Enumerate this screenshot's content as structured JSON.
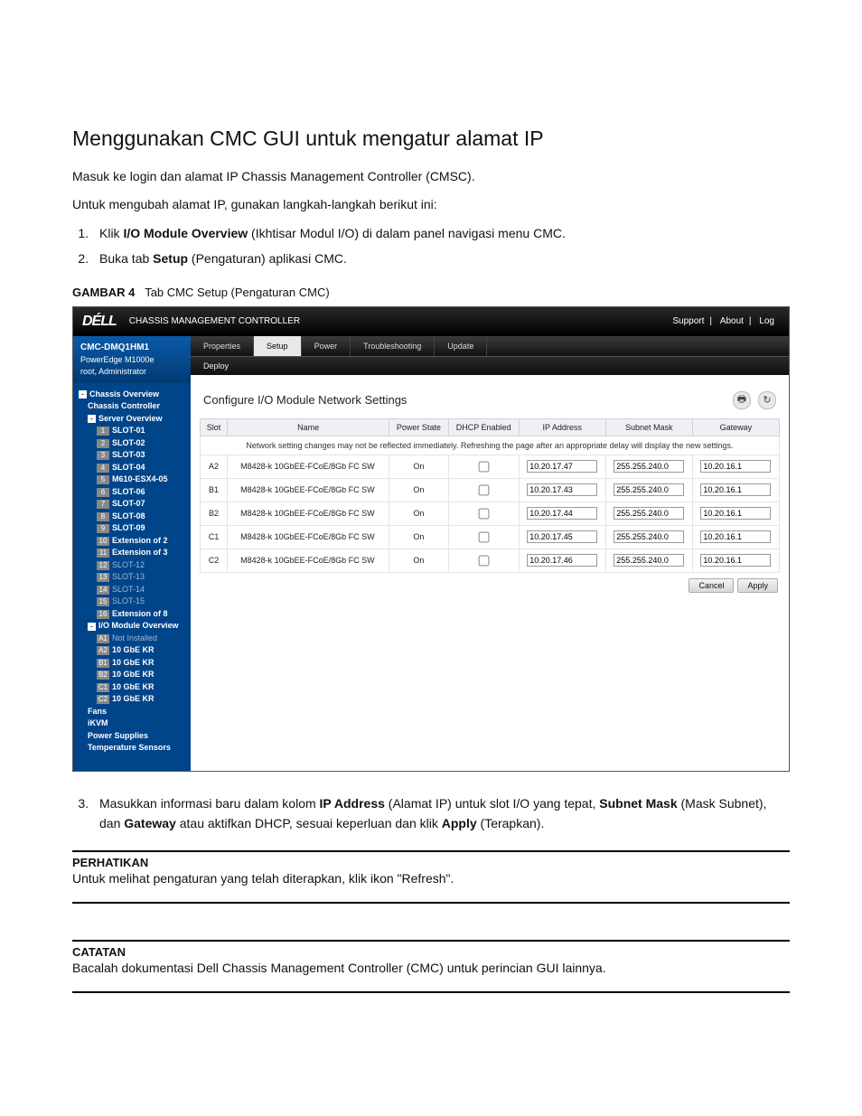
{
  "doc": {
    "heading": "Menggunakan CMC GUI untuk mengatur alamat IP",
    "intro1": "Masuk ke login dan alamat IP Chassis Management Controller (CMSC).",
    "intro2": "Untuk mengubah alamat IP, gunakan langkah-langkah berikut ini:",
    "step1_prefix": "Klik ",
    "step1_bold": "I/O Module Overview",
    "step1_suffix": " (Ikhtisar Modul I/O) di dalam panel navigasi menu CMC.",
    "step2_prefix": "Buka tab ",
    "step2_bold": "Setup",
    "step2_suffix": " (Pengaturan) aplikasi CMC.",
    "figlabel": "GAMBAR 4",
    "figtitle": "Tab CMC Setup (Pengaturan CMC)",
    "step3_a": "Masukkan informasi baru dalam kolom ",
    "step3_b1": "IP Address",
    "step3_b": " (Alamat IP) untuk slot I/O yang tepat, ",
    "step3_b2": "Subnet Mask",
    "step3_c": " (Mask Subnet), dan ",
    "step3_b3": "Gateway",
    "step3_d": " atau aktifkan DHCP, sesuai keperluan dan klik ",
    "step3_b4": "Apply",
    "step3_e": " (Terapkan).",
    "note1_title": "PERHATIKAN",
    "note1_body": "Untuk melihat pengaturan yang telah diterapkan, klik ikon \"Refresh\".",
    "note2_title": "CATATAN",
    "note2_body": "Bacalah dokumentasi Dell Chassis Management Controller (CMC) untuk perincian GUI lainnya."
  },
  "ui": {
    "brand": "DÉLL",
    "apptitle": "CHASSIS MANAGEMENT CONTROLLER",
    "toplinks": {
      "support": "Support",
      "about": "About",
      "log": "Log"
    },
    "chassis": {
      "name": "CMC-DMQ1HM1",
      "model": "PowerEdge M1000e",
      "user": "root, Administrator"
    },
    "tabs": [
      "Properties",
      "Setup",
      "Power",
      "Troubleshooting",
      "Update"
    ],
    "activeTab": 1,
    "subtab": "Deploy",
    "panelTitle": "Configure I/O Module Network Settings",
    "columns": [
      "Slot",
      "Name",
      "Power State",
      "DHCP Enabled",
      "IP Address",
      "Subnet Mask",
      "Gateway"
    ],
    "notice": "Network setting changes may not be reflected immediately. Refreshing the page after an appropriate delay will display the new settings.",
    "rows": [
      {
        "slot": "A2",
        "name": "M8428-k 10GbEE-FCoE/8Gb FC SW",
        "power": "On",
        "dhcp": false,
        "ip": "10.20.17.47",
        "mask": "255.255.240.0",
        "gw": "10.20.16.1"
      },
      {
        "slot": "B1",
        "name": "M8428-k 10GbEE-FCoE/8Gb FC SW",
        "power": "On",
        "dhcp": false,
        "ip": "10.20.17.43",
        "mask": "255.255.240.0",
        "gw": "10.20.16.1"
      },
      {
        "slot": "B2",
        "name": "M8428-k 10GbEE-FCoE/8Gb FC SW",
        "power": "On",
        "dhcp": false,
        "ip": "10.20.17.44",
        "mask": "255.255.240.0",
        "gw": "10.20.16.1"
      },
      {
        "slot": "C1",
        "name": "M8428-k 10GbEE-FCoE/8Gb FC SW",
        "power": "On",
        "dhcp": false,
        "ip": "10.20.17.45",
        "mask": "255.255.240.0",
        "gw": "10.20.16.1"
      },
      {
        "slot": "C2",
        "name": "M8428-k 10GbEE-FCoE/8Gb FC SW",
        "power": "On",
        "dhcp": false,
        "ip": "10.20.17.46",
        "mask": "255.255.240.0",
        "gw": "10.20.16.1"
      }
    ],
    "buttons": {
      "cancel": "Cancel",
      "apply": "Apply"
    },
    "tree": [
      {
        "ind": 0,
        "box": "-",
        "label": "Chassis Overview",
        "bold": true
      },
      {
        "ind": 1,
        "label": "Chassis Controller",
        "bold": true
      },
      {
        "ind": 1,
        "box": "-",
        "label": "Server Overview",
        "bold": true
      },
      {
        "ind": 2,
        "num": "1",
        "label": "SLOT-01",
        "bold": true
      },
      {
        "ind": 2,
        "num": "2",
        "label": "SLOT-02",
        "bold": true
      },
      {
        "ind": 2,
        "num": "3",
        "label": "SLOT-03",
        "bold": true
      },
      {
        "ind": 2,
        "num": "4",
        "label": "SLOT-04",
        "bold": true
      },
      {
        "ind": 2,
        "num": "5",
        "label": "M610-ESX4-05",
        "bold": true
      },
      {
        "ind": 2,
        "num": "6",
        "label": "SLOT-06",
        "bold": true
      },
      {
        "ind": 2,
        "num": "7",
        "label": "SLOT-07",
        "bold": true
      },
      {
        "ind": 2,
        "num": "8",
        "label": "SLOT-08",
        "bold": true
      },
      {
        "ind": 2,
        "num": "9",
        "label": "SLOT-09",
        "bold": true
      },
      {
        "ind": 2,
        "num": "10",
        "label": "Extension of 2",
        "bold": true
      },
      {
        "ind": 2,
        "num": "11",
        "label": "Extension of 3",
        "bold": true
      },
      {
        "ind": 2,
        "num": "12",
        "label": "SLOT-12",
        "dim": true
      },
      {
        "ind": 2,
        "num": "13",
        "label": "SLOT-13",
        "dim": true
      },
      {
        "ind": 2,
        "num": "14",
        "label": "SLOT-14",
        "dim": true
      },
      {
        "ind": 2,
        "num": "15",
        "label": "SLOT-15",
        "dim": true
      },
      {
        "ind": 2,
        "num": "16",
        "label": "Extension of 8",
        "bold": true
      },
      {
        "ind": 1,
        "box": "-",
        "label": "I/O Module Overview",
        "bold": true
      },
      {
        "ind": 2,
        "num": "A1",
        "label": "Not Installed",
        "dim": true
      },
      {
        "ind": 2,
        "num": "A2",
        "label": "10 GbE KR",
        "bold": true
      },
      {
        "ind": 2,
        "num": "B1",
        "label": "10 GbE KR",
        "bold": true
      },
      {
        "ind": 2,
        "num": "B2",
        "label": "10 GbE KR",
        "bold": true
      },
      {
        "ind": 2,
        "num": "C1",
        "label": "10 GbE KR",
        "bold": true
      },
      {
        "ind": 2,
        "num": "C2",
        "label": "10 GbE KR",
        "bold": true
      },
      {
        "ind": 1,
        "label": "Fans",
        "bold": true
      },
      {
        "ind": 1,
        "label": "iKVM",
        "bold": true
      },
      {
        "ind": 1,
        "label": "Power Supplies",
        "bold": true
      },
      {
        "ind": 1,
        "label": "Temperature Sensors",
        "bold": true
      }
    ]
  }
}
